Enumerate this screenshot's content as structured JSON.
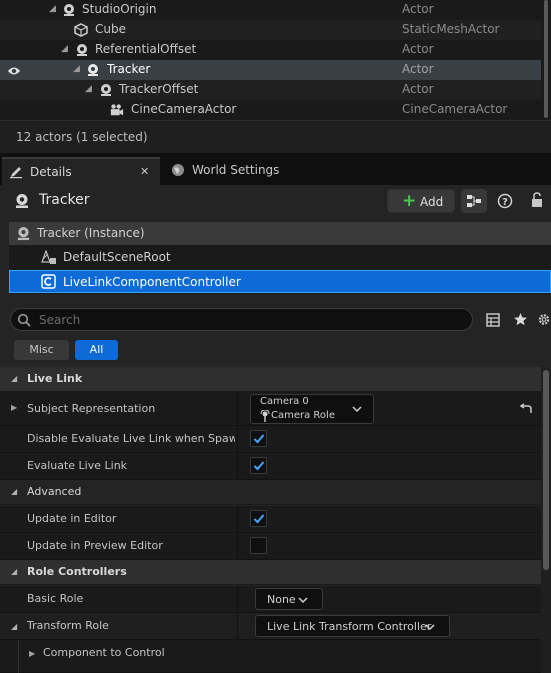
{
  "outliner": {
    "rows": [
      {
        "name": "StudioOrigin",
        "type": "Actor"
      },
      {
        "name": "Cube",
        "type": "StaticMeshActor"
      },
      {
        "name": "ReferentialOffset",
        "type": "Actor"
      },
      {
        "name": "Tracker",
        "type": "Actor"
      },
      {
        "name": "TrackerOffset",
        "type": "Actor"
      },
      {
        "name": "CineCameraActor",
        "type": "CineCameraActor"
      }
    ],
    "footer": "12 actors (1 selected)"
  },
  "tabs": {
    "details": "Details",
    "world_settings": "World Settings",
    "close": "✕"
  },
  "details": {
    "title": "Tracker",
    "add_label": "Add",
    "components": {
      "instance": "Tracker (Instance)",
      "root": "DefaultSceneRoot",
      "controller": "LiveLinkComponentController"
    },
    "search_placeholder": "Search",
    "filters": {
      "misc": "Misc",
      "all": "All"
    },
    "categories": {
      "live_link": "Live Link",
      "advanced": "Advanced",
      "role_controllers": "Role Controllers"
    },
    "props": {
      "subject_representation": "Subject Representation",
      "subject_value_line1": "Camera 0",
      "subject_value_line2": "Camera Role",
      "disable_eval": "Disable Evaluate Live Link when Spawna...",
      "evaluate": "Evaluate Live Link",
      "update_editor": "Update in Editor",
      "update_preview": "Update in Preview Editor",
      "basic_role": "Basic Role",
      "basic_role_value": "None",
      "transform_role": "Transform Role",
      "transform_role_value": "Live Link Transform Controller",
      "component_to_control": "Component to Control"
    },
    "checkboxes": {
      "disable_eval": true,
      "evaluate": true,
      "update_editor": true,
      "update_preview": false
    }
  },
  "colors": {
    "accent": "#0e6ad6",
    "add_plus": "#4fc34f"
  }
}
